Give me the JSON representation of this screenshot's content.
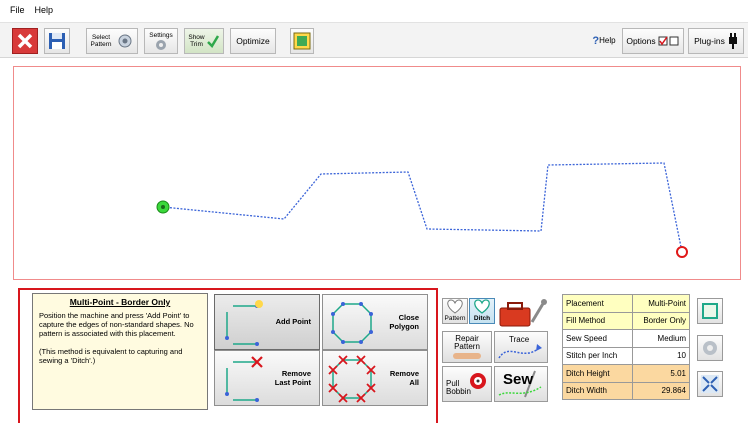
{
  "menu": {
    "file": "File",
    "help": "Help"
  },
  "toolbar": {
    "select_pattern_top": "Select",
    "select_pattern_bottom": "Pattern",
    "settings": "Settings",
    "show_trim_top": "Show",
    "show_trim_bottom": "Trim",
    "optimize": "Optimize",
    "help_label": "Help",
    "options_label": "Options",
    "plugins_label": "Plug-ins"
  },
  "info": {
    "title": "Multi-Point - Border Only",
    "para1": "Position the machine and press 'Add Point' to capture the edges of non-standard shapes. No pattern is associated with this placement.",
    "para2": "(This method is equivalent to capturing and sewing a 'Ditch'.)"
  },
  "point_buttons": {
    "add": "Add Point",
    "close_top": "Close",
    "close_bottom": "Polygon",
    "remove_last_top": "Remove",
    "remove_last_bottom": "Last Point",
    "remove_all_top": "Remove",
    "remove_all_bottom": "All"
  },
  "tools": {
    "pattern": "Pattern",
    "ditch": "Ditch",
    "repair_top": "Repair",
    "repair_bottom": "Pattern",
    "trace": "Trace",
    "pull_top": "Pull",
    "pull_bottom": "Bobbin",
    "sew": "Sew"
  },
  "properties": [
    {
      "label": "Placement",
      "value": "Multi-Point",
      "style": "yellow"
    },
    {
      "label": "Fill Method",
      "value": "Border Only",
      "style": "yellow"
    },
    {
      "label": "Sew Speed",
      "value": "Medium",
      "style": "white"
    },
    {
      "label": "Stitch per Inch",
      "value": "10",
      "style": "white"
    },
    {
      "label": "Ditch Height",
      "value": "5.01",
      "style": "orange"
    },
    {
      "label": "Ditch Width",
      "value": "29.864",
      "style": "orange"
    }
  ],
  "colors": {
    "accent_red": "#d8161d",
    "stitch_blue": "#3b64d8",
    "start_green": "#3bd83b"
  }
}
